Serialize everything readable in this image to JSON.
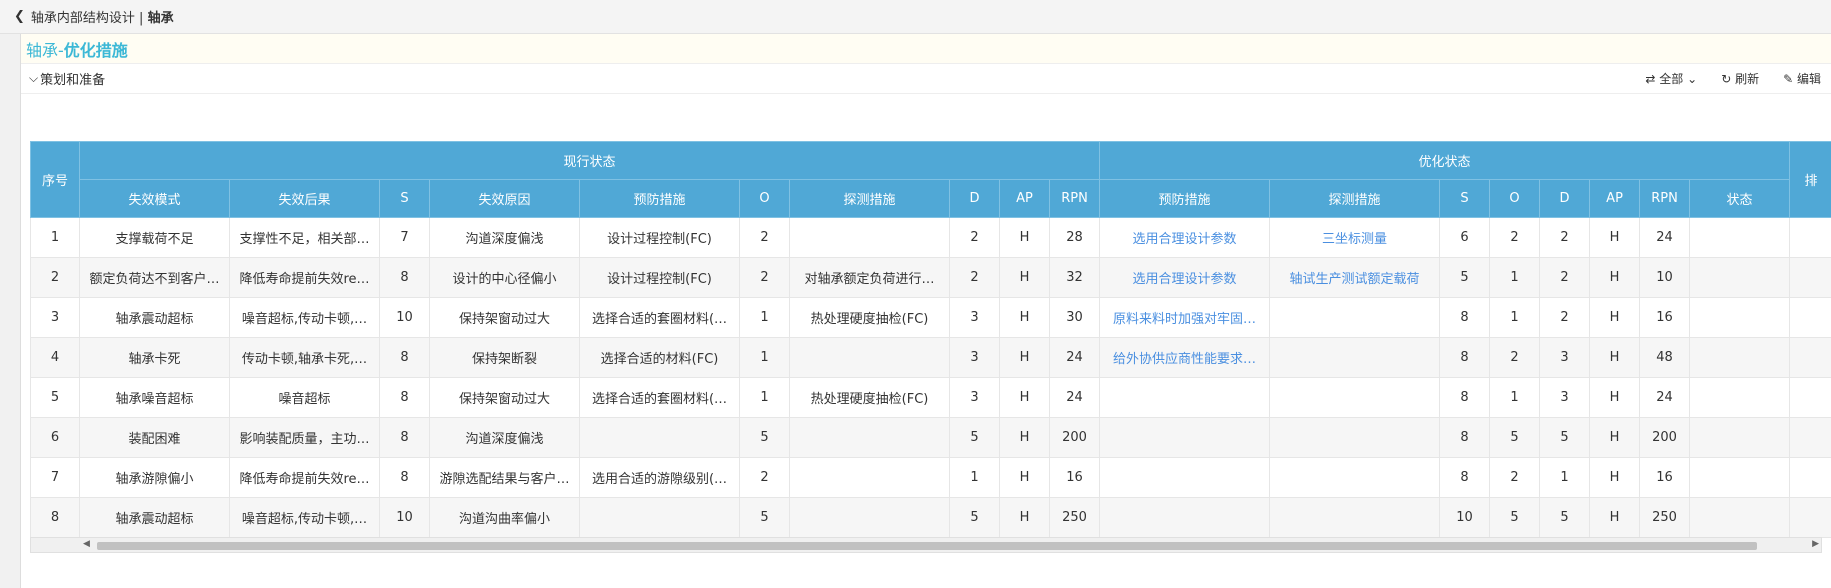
{
  "topbar": {
    "back_icon": "chevron-left-icon",
    "breadcrumb_prefix": "轴承内部结构设计 | ",
    "breadcrumb_current": "轴承"
  },
  "title": {
    "prefix": "轴承- ",
    "main": "优化措施"
  },
  "section": {
    "label": "策划和准备"
  },
  "toolbar": {
    "all_label": "全部",
    "refresh_label": "刷新",
    "edit_label": "编辑"
  },
  "table": {
    "header_group": {
      "index": "序号",
      "current": "现行状态",
      "optimized": "优化状态",
      "cut": "排"
    },
    "columns": [
      "失效模式",
      "失效后果",
      "S",
      "失效原因",
      "预防措施",
      "O",
      "探测措施",
      "D",
      "AP",
      "RPN",
      "预防措施",
      "探测措施",
      "S",
      "O",
      "D",
      "AP",
      "RPN",
      "状态"
    ],
    "rows": [
      [
        "1",
        "支撑载荷不足",
        "支撑性不足，相关部…",
        "7",
        "沟道深度偏浅",
        "设计过程控制(FC)",
        "2",
        "",
        "2",
        "H",
        "28",
        "选用合理设计参数",
        "三坐标测量",
        "6",
        "2",
        "2",
        "H",
        "24",
        ""
      ],
      [
        "2",
        "额定负荷达不到客户…",
        "降低寿命提前失效re…",
        "8",
        "设计的中心径偏小",
        "设计过程控制(FC)",
        "2",
        "对轴承额定负荷进行…",
        "2",
        "H",
        "32",
        "选用合理设计参数",
        "轴试生产测试额定载荷",
        "5",
        "1",
        "2",
        "H",
        "10",
        ""
      ],
      [
        "3",
        "轴承震动超标",
        "噪音超标,传动卡顿,…",
        "10",
        "保持架窗动过大",
        "选择合适的套圈材料(…",
        "1",
        "热处理硬度抽检(FC)",
        "3",
        "H",
        "30",
        "原料来料时加强对牢固…",
        "",
        "8",
        "1",
        "2",
        "H",
        "16",
        ""
      ],
      [
        "4",
        "轴承卡死",
        "传动卡顿,轴承卡死,…",
        "8",
        "保持架断裂",
        "选择合适的材料(FC)",
        "1",
        "",
        "3",
        "H",
        "24",
        "给外协供应商性能要求…",
        "",
        "8",
        "2",
        "3",
        "H",
        "48",
        ""
      ],
      [
        "5",
        "轴承噪音超标",
        "噪音超标",
        "8",
        "保持架窗动过大",
        "选择合适的套圈材料(…",
        "1",
        "热处理硬度抽检(FC)",
        "3",
        "H",
        "24",
        "",
        "",
        "8",
        "1",
        "3",
        "H",
        "24",
        ""
      ],
      [
        "6",
        "装配困难",
        "影响装配质量，主功…",
        "8",
        "沟道深度偏浅",
        "",
        "5",
        "",
        "5",
        "H",
        "200",
        "",
        "",
        "8",
        "5",
        "5",
        "H",
        "200",
        ""
      ],
      [
        "7",
        "轴承游隙偏小",
        "降低寿命提前失效re…",
        "8",
        "游隙选配结果与客户…",
        "选用合适的游隙级别(…",
        "2",
        "",
        "1",
        "H",
        "16",
        "",
        "",
        "8",
        "2",
        "1",
        "H",
        "16",
        ""
      ],
      [
        "8",
        "轴承震动超标",
        "噪音超标,传动卡顿,…",
        "10",
        "沟道沟曲率偏小",
        "",
        "5",
        "",
        "5",
        "H",
        "250",
        "",
        "",
        "10",
        "5",
        "5",
        "H",
        "250",
        ""
      ]
    ]
  }
}
